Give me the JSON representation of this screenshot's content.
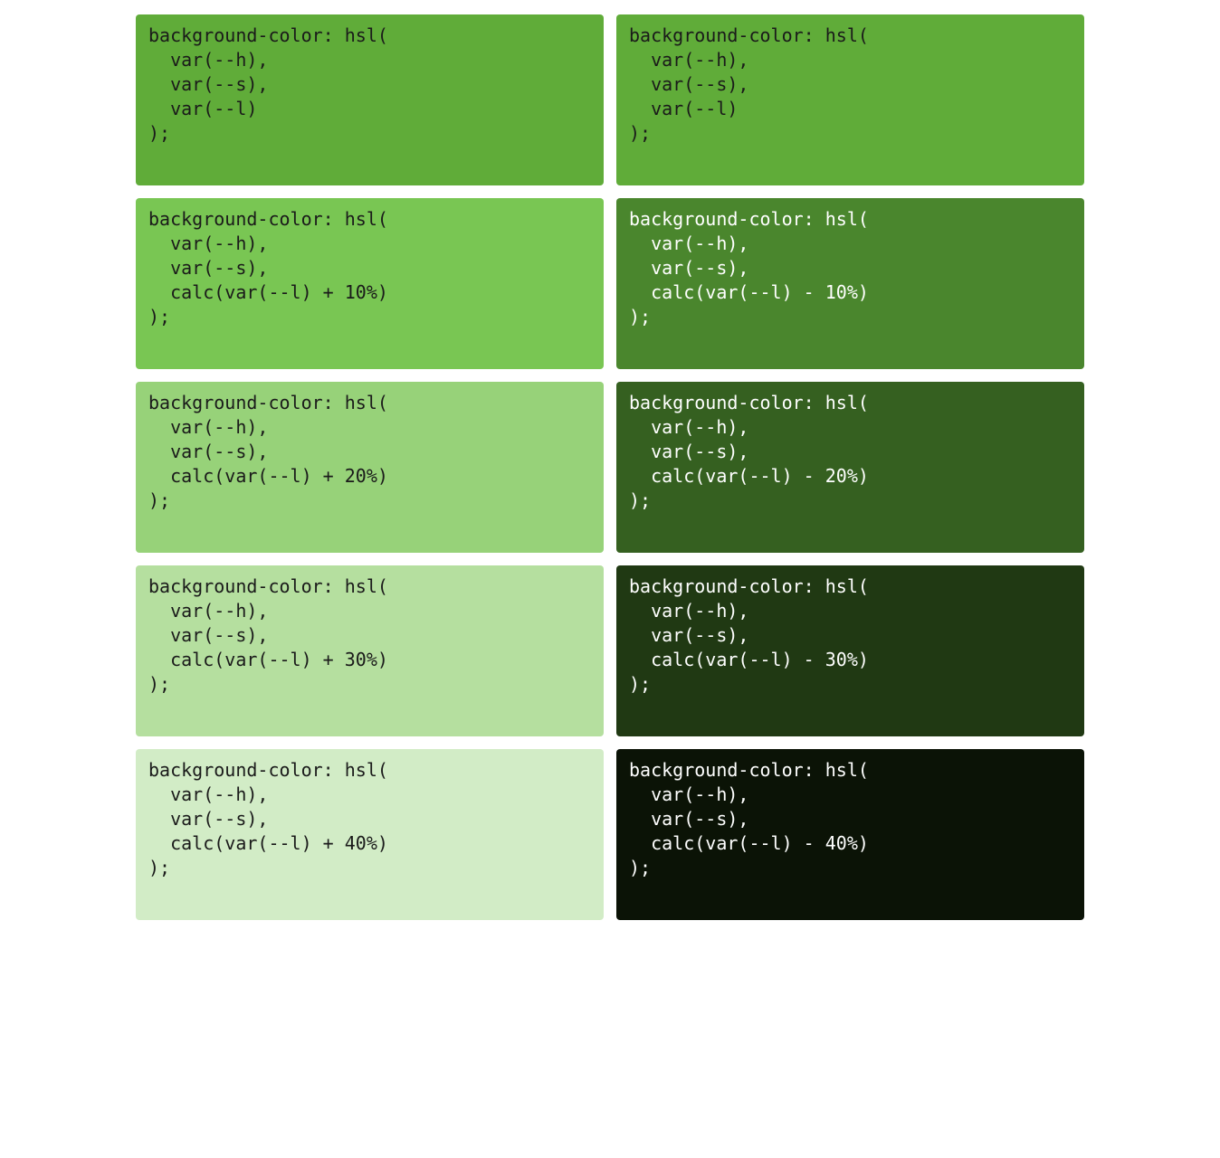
{
  "hsl": {
    "h": 100,
    "s": 50,
    "l": 45
  },
  "base_code": "background-color: hsl(\n  var(--h),\n  var(--s),\n  var(--l)\n);",
  "positions": [
    {
      "key": "left0"
    },
    {
      "key": "right0"
    },
    {
      "key": "left1"
    },
    {
      "key": "right1"
    },
    {
      "key": "left2"
    },
    {
      "key": "right2"
    },
    {
      "key": "left3"
    },
    {
      "key": "right3"
    },
    {
      "key": "left4"
    },
    {
      "key": "right4"
    }
  ],
  "swatches": {
    "left0": {
      "delta": 0,
      "text_on_dark": false,
      "code": "background-color: hsl(\n  var(--h),\n  var(--s),\n  var(--l)\n);"
    },
    "right0": {
      "delta": 0,
      "text_on_dark": false,
      "code": "background-color: hsl(\n  var(--h),\n  var(--s),\n  var(--l)\n);"
    },
    "left1": {
      "delta": 10,
      "text_on_dark": false,
      "code": "background-color: hsl(\n  var(--h),\n  var(--s),\n  calc(var(--l) + 10%)\n);"
    },
    "right1": {
      "delta": -10,
      "text_on_dark": true,
      "code": "background-color: hsl(\n  var(--h),\n  var(--s),\n  calc(var(--l) - 10%)\n);"
    },
    "left2": {
      "delta": 20,
      "text_on_dark": false,
      "code": "background-color: hsl(\n  var(--h),\n  var(--s),\n  calc(var(--l) + 20%)\n);"
    },
    "right2": {
      "delta": -20,
      "text_on_dark": true,
      "code": "background-color: hsl(\n  var(--h),\n  var(--s),\n  calc(var(--l) - 20%)\n);"
    },
    "left3": {
      "delta": 30,
      "text_on_dark": false,
      "code": "background-color: hsl(\n  var(--h),\n  var(--s),\n  calc(var(--l) + 30%)\n);"
    },
    "right3": {
      "delta": -30,
      "text_on_dark": true,
      "code": "background-color: hsl(\n  var(--h),\n  var(--s),\n  calc(var(--l) - 30%)\n);"
    },
    "left4": {
      "delta": 40,
      "text_on_dark": false,
      "code": "background-color: hsl(\n  var(--h),\n  var(--s),\n  calc(var(--l) + 40%)\n);"
    },
    "right4": {
      "delta": -40,
      "text_on_dark": true,
      "code": "background-color: hsl(\n  var(--h),\n  var(--s),\n  calc(var(--l) - 40%)\n);"
    }
  }
}
